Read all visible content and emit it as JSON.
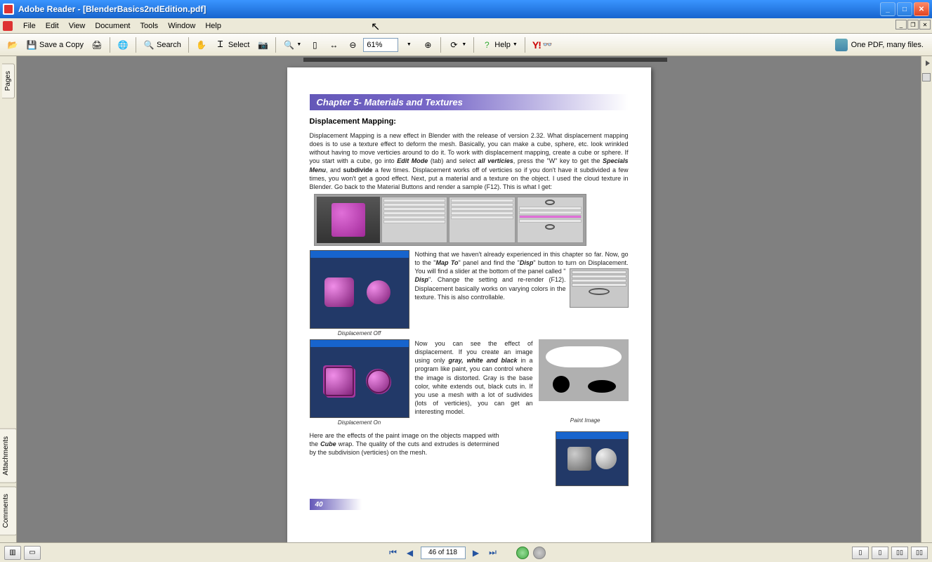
{
  "titlebar": {
    "text": "Adobe Reader - [BlenderBasics2ndEdition.pdf]"
  },
  "menu": {
    "items": [
      "File",
      "Edit",
      "View",
      "Document",
      "Tools",
      "Window",
      "Help"
    ]
  },
  "toolbar": {
    "save_copy": "Save a Copy",
    "search": "Search",
    "select": "Select",
    "help": "Help",
    "zoom": "61%",
    "promo": "One PDF, many files.",
    "yahoo": "Y!"
  },
  "side": {
    "pages": "Pages",
    "attachments": "Attachments",
    "comments": "Comments"
  },
  "page": {
    "chapter": "Chapter 5- Materials and Textures",
    "section": "Displacement Mapping:",
    "para1a": "Displacement Mapping is a new effect in Blender with the release of version 2.32. What displacement mapping does is to use a texture effect to deform the mesh. Basically, you can make a cube, sphere, etc. look wrinkled without having to move verticies around to do it. To work with displacement mapping, create a cube or sphere. If you start with a cube, go into ",
    "para1_edit": "Edit Mode",
    "para1b": " (tab) and select ",
    "para1_allv": "all verticies",
    "para1c": ", press the \"W\" key to get the ",
    "para1_spec": "Specials Menu",
    "para1d": ", and ",
    "para1_sub": "subdivide",
    "para1e": " a few times. Displacement works off of verticies so if you don't have it subdivided a few times, you won't get a good effect. Next, put a material and a texture on the object. I used the cloud texture in Blender. Go back to the Material Buttons and render a sample (F12). This is what I get:",
    "para2a": "Nothing that we haven't already experienced in this chapter so far. Now, go to the \"",
    "para2_mapto": "Map To",
    "para2b": "\" panel and find the \"",
    "para2_disp": "Disp",
    "para2c": "\" button to turn on Displacement. You will find a slider at the bottom of the panel called \"",
    "para2_disp2": "Disp",
    "para2d": "\". Change the setting and re-render (F12). Displacement basically works on varying colors in the texture. This is also controllable.",
    "cap_off": "Displacement Off",
    "para3a": "Now you can see the effect of displacement. If you create an image using only ",
    "para3_gwb": "gray, white and black",
    "para3b": " in a program like paint, you can control where the image is distorted. Gray is the base color, white extends out, black cuts in. If you use a mesh with a lot of sudivides (lots of verticies), you can get an interesting model.",
    "cap_on": "Displacement On",
    "cap_paint": "Paint Image",
    "para4a": "Here are the effects of the paint image on the objects mapped with the ",
    "para4_cube": "Cube",
    "para4b": " wrap. The quality of the cuts and extrudes is determined by the subdivision (verticies) on the mesh.",
    "num": "40"
  },
  "nav": {
    "page_display": "46 of 118"
  }
}
